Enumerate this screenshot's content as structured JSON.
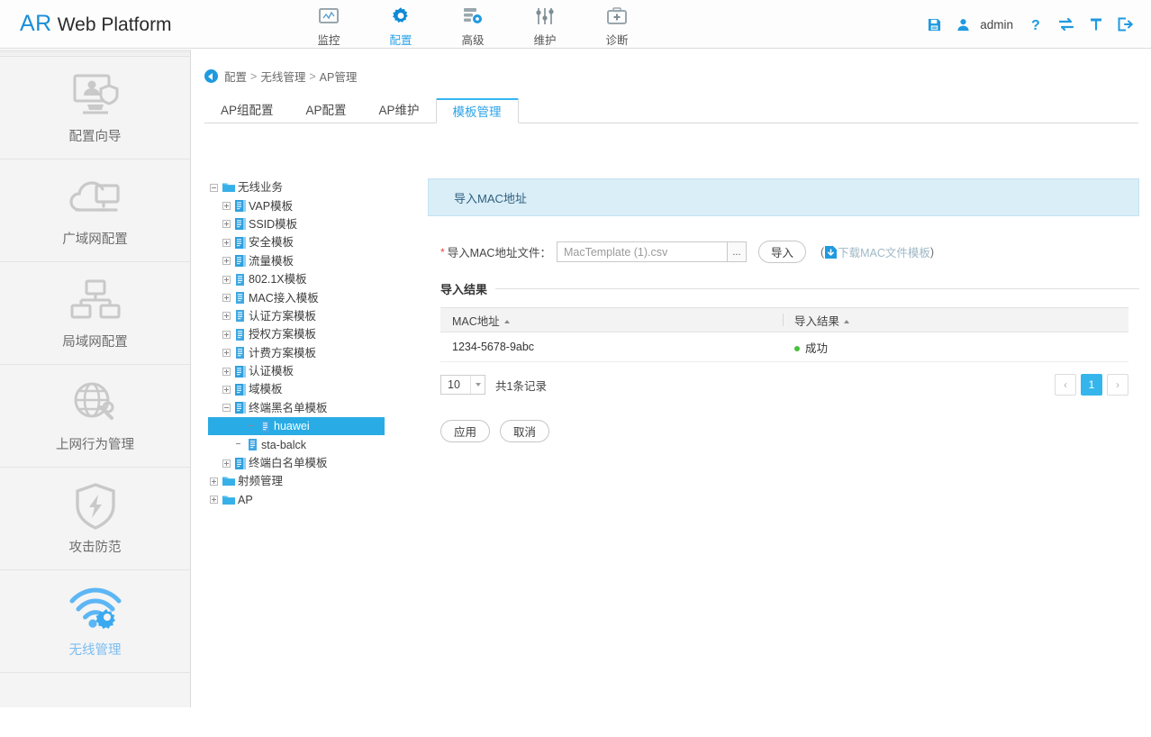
{
  "header": {
    "logo_primary": "AR",
    "logo_secondary": "Web Platform",
    "nav": [
      {
        "label": "监控",
        "icon": "monitor-icon",
        "active": false
      },
      {
        "label": "配置",
        "icon": "gear-icon",
        "active": true
      },
      {
        "label": "高级",
        "icon": "advanced-icon",
        "active": false
      },
      {
        "label": "维护",
        "icon": "sliders-icon",
        "active": false
      },
      {
        "label": "诊断",
        "icon": "diagnose-icon",
        "active": false
      }
    ],
    "user": "admin",
    "right_icons": [
      "save-icon",
      "user-icon",
      "help-icon",
      "switch-icon",
      "pin-icon",
      "logout-icon"
    ]
  },
  "sidebar": {
    "items": [
      {
        "label": "配置向导",
        "icon": "wizard-icon",
        "active": false
      },
      {
        "label": "广域网配置",
        "icon": "wan-icon",
        "active": false
      },
      {
        "label": "局域网配置",
        "icon": "lan-icon",
        "active": false
      },
      {
        "label": "上网行为管理",
        "icon": "internet-behavior-icon",
        "active": false
      },
      {
        "label": "攻击防范",
        "icon": "shield-bolt-icon",
        "active": false
      },
      {
        "label": "无线管理",
        "icon": "wifi-gear-icon",
        "active": true
      }
    ]
  },
  "breadcrumb": {
    "back_icon": "back-arrow-icon",
    "parts": [
      "配置",
      "无线管理",
      "AP管理"
    ],
    "separator": ">"
  },
  "tabs": [
    {
      "label": "AP组配置",
      "active": false
    },
    {
      "label": "AP配置",
      "active": false
    },
    {
      "label": "AP维护",
      "active": false
    },
    {
      "label": "模板管理",
      "active": true
    }
  ],
  "tree": [
    {
      "label": "无线业务",
      "depth": 0,
      "toggle": "minus",
      "icon": "folder-icon",
      "selected": false
    },
    {
      "label": "VAP模板",
      "depth": 1,
      "toggle": "plus",
      "icon": "template-blue-icon",
      "selected": false
    },
    {
      "label": "SSID模板",
      "depth": 1,
      "toggle": "plus",
      "icon": "template-blue-icon",
      "selected": false
    },
    {
      "label": "安全模板",
      "depth": 1,
      "toggle": "plus",
      "icon": "template-blue-icon",
      "selected": false
    },
    {
      "label": "流量模板",
      "depth": 1,
      "toggle": "plus",
      "icon": "template-blue-icon",
      "selected": false
    },
    {
      "label": "802.1X模板",
      "depth": 1,
      "toggle": "plus",
      "icon": "template-doc-icon",
      "selected": false
    },
    {
      "label": "MAC接入模板",
      "depth": 1,
      "toggle": "plus",
      "icon": "template-doc-icon",
      "selected": false
    },
    {
      "label": "认证方案模板",
      "depth": 1,
      "toggle": "plus",
      "icon": "template-doc-icon",
      "selected": false
    },
    {
      "label": "授权方案模板",
      "depth": 1,
      "toggle": "plus",
      "icon": "template-doc-icon",
      "selected": false
    },
    {
      "label": "计费方案模板",
      "depth": 1,
      "toggle": "plus",
      "icon": "template-doc-icon",
      "selected": false
    },
    {
      "label": "认证模板",
      "depth": 1,
      "toggle": "plus",
      "icon": "template-blue-icon",
      "selected": false
    },
    {
      "label": "域模板",
      "depth": 1,
      "toggle": "plus",
      "icon": "template-blue-icon",
      "selected": false
    },
    {
      "label": "终端黑名单模板",
      "depth": 1,
      "toggle": "minus",
      "icon": "template-blue-icon",
      "selected": false
    },
    {
      "label": "huawei",
      "depth": 2,
      "toggle": "none",
      "icon": "template-doc-icon",
      "selected": true
    },
    {
      "label": "sta-balck",
      "depth": 2,
      "toggle": "none",
      "icon": "template-doc-icon",
      "selected": false
    },
    {
      "label": "终端白名单模板",
      "depth": 1,
      "toggle": "plus",
      "icon": "template-blue-icon",
      "selected": false
    },
    {
      "label": "射频管理",
      "depth": 0,
      "toggle": "plus",
      "icon": "folder-icon",
      "selected": false
    },
    {
      "label": "AP",
      "depth": 0,
      "toggle": "plus",
      "icon": "folder-icon",
      "selected": false
    }
  ],
  "panel": {
    "title": "导入MAC地址",
    "form": {
      "required_mark": "*",
      "file_label": "导入MAC地址文件：",
      "file_value": "MacTemplate (1).csv",
      "browse_label": "...",
      "import_label": "导入",
      "download_prefix": "(",
      "download_icon": "download-icon",
      "download_label": "下载MAC文件模板",
      "download_suffix": ")"
    },
    "result_section_title": "导入结果",
    "table": {
      "columns": [
        "MAC地址",
        "导入结果"
      ],
      "rows": [
        {
          "mac": "1234-5678-9abc",
          "result": "成功",
          "status_color": "#48c23a"
        }
      ]
    },
    "pager": {
      "page_size": "10",
      "total_text": "共1条记录",
      "prev_label": "‹",
      "next_label": "›",
      "pages": [
        "1"
      ],
      "current_page": "1"
    },
    "buttons": {
      "apply": "应用",
      "cancel": "取消"
    }
  },
  "colors": {
    "accent": "#29ace5",
    "accent_dark": "#1b8ed6",
    "panel_head_bg": "#daeef8",
    "success": "#48c23a"
  }
}
